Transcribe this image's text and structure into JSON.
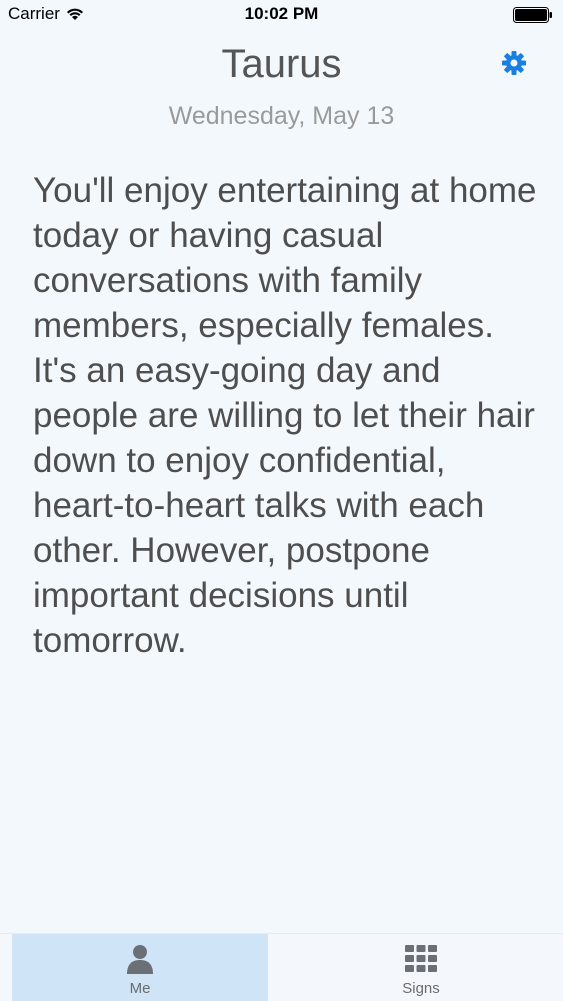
{
  "status_bar": {
    "carrier": "Carrier",
    "time": "10:02 PM",
    "icons": [
      "wifi-icon",
      "battery-icon"
    ]
  },
  "header": {
    "title": "Taurus",
    "settings_icon": "gear-icon",
    "date": "Wednesday, May 13"
  },
  "horoscope": {
    "text": "You'll enjoy entertaining at home today or having casual conversations with family members, especially females. It's an easy-going day and people are willing to let their hair down to enjoy confidential, heart-to-heart talks with each other. However, postpone important decisions until tomorrow."
  },
  "tab_bar": {
    "tabs": [
      {
        "label": "Me",
        "icon": "person-icon",
        "selected": true
      },
      {
        "label": "Signs",
        "icon": "grid-icon",
        "selected": false
      }
    ]
  },
  "colors": {
    "background": "#f3f8fd",
    "accent": "#1a7fe0",
    "selected_tab": "#cfe4f7"
  }
}
